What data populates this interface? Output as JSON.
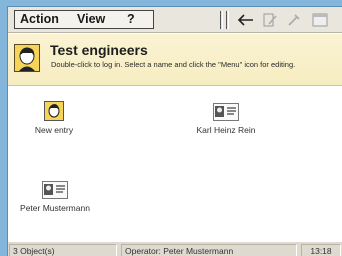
{
  "menubar": {
    "items": [
      "Action",
      "View",
      "?"
    ],
    "toolbar_icons": [
      "back-arrow-icon",
      "edit-icon",
      "tools-icon",
      "window-icon"
    ]
  },
  "header": {
    "title": "Test engineers",
    "description": "Double-click to log in. Select a name and click the \"Menu\" icon for editing."
  },
  "entries": [
    {
      "label": "New entry",
      "icon": "new-user-icon"
    },
    {
      "label": "Karl Heinz Rein",
      "icon": "user-card-icon"
    },
    {
      "label": "Peter Mustermann",
      "icon": "user-card-icon"
    }
  ],
  "statusbar": {
    "object_count": "3 Object(s)",
    "operator": "Operator: Peter Mustermann",
    "time": "13:18"
  },
  "colors": {
    "desktop": "#84b6dc",
    "header_bg": "#faf3d2",
    "icon_yellow": "#f6d45a",
    "bar_gray": "#e9e6de"
  }
}
